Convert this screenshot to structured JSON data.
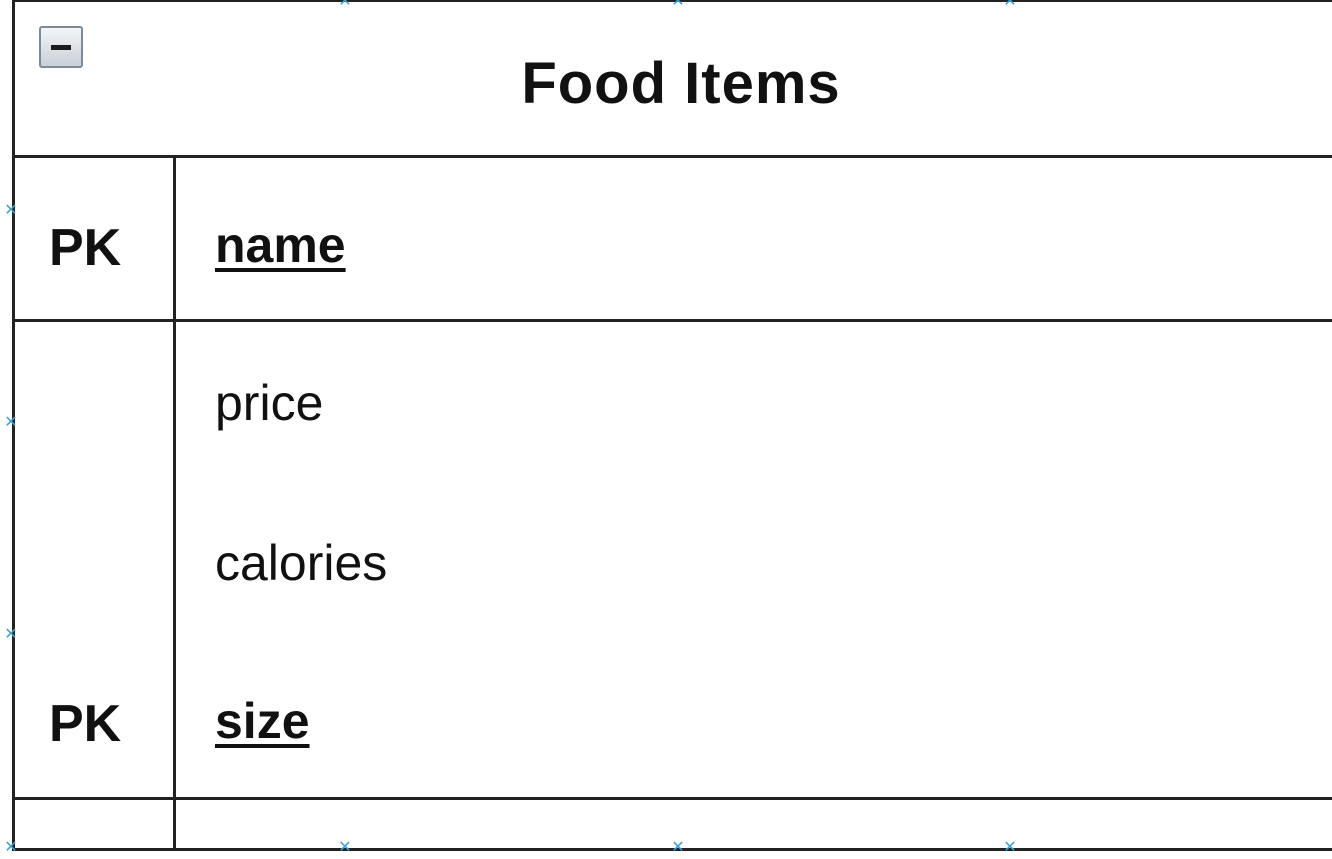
{
  "entity": {
    "title": "Food Items",
    "collapse_icon": "minus-icon",
    "primary_key_label": "PK",
    "primary_key": {
      "key": "PK",
      "attribute": "name"
    },
    "attributes": [
      {
        "key": "",
        "name": "price"
      },
      {
        "key": "",
        "name": "calories"
      },
      {
        "key": "PK",
        "name": "size"
      }
    ]
  },
  "colors": {
    "border": "#222222",
    "handle": "#3aa0d8",
    "text": "#111111"
  }
}
